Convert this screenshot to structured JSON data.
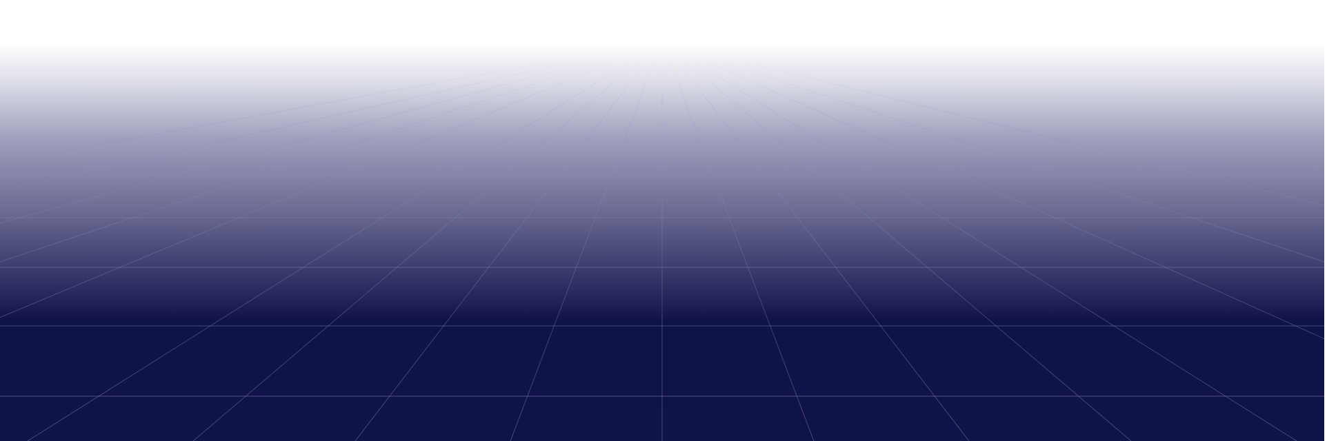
{
  "colors": {
    "horizon": "#ffffff",
    "floor": "#10124a",
    "grid_line": "#8a8db5"
  },
  "scene": {
    "description_label": ""
  }
}
